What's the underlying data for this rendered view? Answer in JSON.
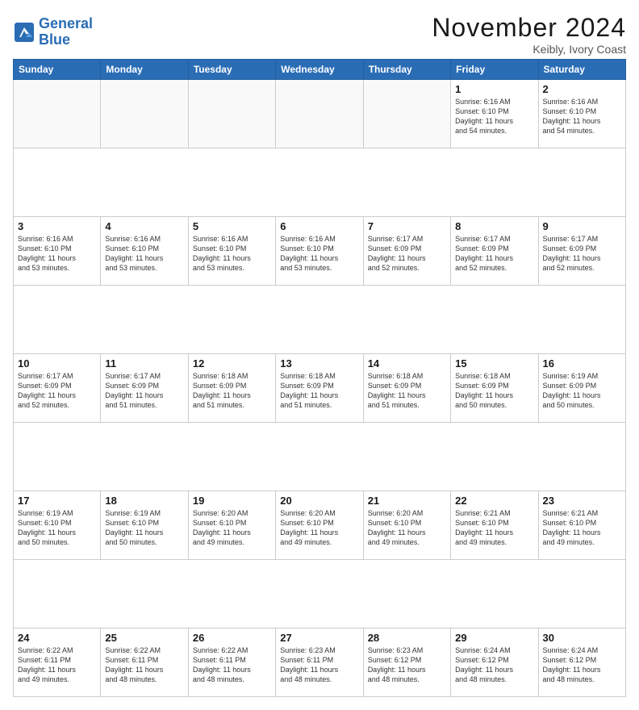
{
  "header": {
    "logo_line1": "General",
    "logo_line2": "Blue",
    "title": "November 2024",
    "location": "Keibly, Ivory Coast"
  },
  "weekdays": [
    "Sunday",
    "Monday",
    "Tuesday",
    "Wednesday",
    "Thursday",
    "Friday",
    "Saturday"
  ],
  "weeks": [
    [
      {
        "day": "",
        "info": ""
      },
      {
        "day": "",
        "info": ""
      },
      {
        "day": "",
        "info": ""
      },
      {
        "day": "",
        "info": ""
      },
      {
        "day": "",
        "info": ""
      },
      {
        "day": "1",
        "info": "Sunrise: 6:16 AM\nSunset: 6:10 PM\nDaylight: 11 hours\nand 54 minutes."
      },
      {
        "day": "2",
        "info": "Sunrise: 6:16 AM\nSunset: 6:10 PM\nDaylight: 11 hours\nand 54 minutes."
      }
    ],
    [
      {
        "day": "3",
        "info": "Sunrise: 6:16 AM\nSunset: 6:10 PM\nDaylight: 11 hours\nand 53 minutes."
      },
      {
        "day": "4",
        "info": "Sunrise: 6:16 AM\nSunset: 6:10 PM\nDaylight: 11 hours\nand 53 minutes."
      },
      {
        "day": "5",
        "info": "Sunrise: 6:16 AM\nSunset: 6:10 PM\nDaylight: 11 hours\nand 53 minutes."
      },
      {
        "day": "6",
        "info": "Sunrise: 6:16 AM\nSunset: 6:10 PM\nDaylight: 11 hours\nand 53 minutes."
      },
      {
        "day": "7",
        "info": "Sunrise: 6:17 AM\nSunset: 6:09 PM\nDaylight: 11 hours\nand 52 minutes."
      },
      {
        "day": "8",
        "info": "Sunrise: 6:17 AM\nSunset: 6:09 PM\nDaylight: 11 hours\nand 52 minutes."
      },
      {
        "day": "9",
        "info": "Sunrise: 6:17 AM\nSunset: 6:09 PM\nDaylight: 11 hours\nand 52 minutes."
      }
    ],
    [
      {
        "day": "10",
        "info": "Sunrise: 6:17 AM\nSunset: 6:09 PM\nDaylight: 11 hours\nand 52 minutes."
      },
      {
        "day": "11",
        "info": "Sunrise: 6:17 AM\nSunset: 6:09 PM\nDaylight: 11 hours\nand 51 minutes."
      },
      {
        "day": "12",
        "info": "Sunrise: 6:18 AM\nSunset: 6:09 PM\nDaylight: 11 hours\nand 51 minutes."
      },
      {
        "day": "13",
        "info": "Sunrise: 6:18 AM\nSunset: 6:09 PM\nDaylight: 11 hours\nand 51 minutes."
      },
      {
        "day": "14",
        "info": "Sunrise: 6:18 AM\nSunset: 6:09 PM\nDaylight: 11 hours\nand 51 minutes."
      },
      {
        "day": "15",
        "info": "Sunrise: 6:18 AM\nSunset: 6:09 PM\nDaylight: 11 hours\nand 50 minutes."
      },
      {
        "day": "16",
        "info": "Sunrise: 6:19 AM\nSunset: 6:09 PM\nDaylight: 11 hours\nand 50 minutes."
      }
    ],
    [
      {
        "day": "17",
        "info": "Sunrise: 6:19 AM\nSunset: 6:10 PM\nDaylight: 11 hours\nand 50 minutes."
      },
      {
        "day": "18",
        "info": "Sunrise: 6:19 AM\nSunset: 6:10 PM\nDaylight: 11 hours\nand 50 minutes."
      },
      {
        "day": "19",
        "info": "Sunrise: 6:20 AM\nSunset: 6:10 PM\nDaylight: 11 hours\nand 49 minutes."
      },
      {
        "day": "20",
        "info": "Sunrise: 6:20 AM\nSunset: 6:10 PM\nDaylight: 11 hours\nand 49 minutes."
      },
      {
        "day": "21",
        "info": "Sunrise: 6:20 AM\nSunset: 6:10 PM\nDaylight: 11 hours\nand 49 minutes."
      },
      {
        "day": "22",
        "info": "Sunrise: 6:21 AM\nSunset: 6:10 PM\nDaylight: 11 hours\nand 49 minutes."
      },
      {
        "day": "23",
        "info": "Sunrise: 6:21 AM\nSunset: 6:10 PM\nDaylight: 11 hours\nand 49 minutes."
      }
    ],
    [
      {
        "day": "24",
        "info": "Sunrise: 6:22 AM\nSunset: 6:11 PM\nDaylight: 11 hours\nand 49 minutes."
      },
      {
        "day": "25",
        "info": "Sunrise: 6:22 AM\nSunset: 6:11 PM\nDaylight: 11 hours\nand 48 minutes."
      },
      {
        "day": "26",
        "info": "Sunrise: 6:22 AM\nSunset: 6:11 PM\nDaylight: 11 hours\nand 48 minutes."
      },
      {
        "day": "27",
        "info": "Sunrise: 6:23 AM\nSunset: 6:11 PM\nDaylight: 11 hours\nand 48 minutes."
      },
      {
        "day": "28",
        "info": "Sunrise: 6:23 AM\nSunset: 6:12 PM\nDaylight: 11 hours\nand 48 minutes."
      },
      {
        "day": "29",
        "info": "Sunrise: 6:24 AM\nSunset: 6:12 PM\nDaylight: 11 hours\nand 48 minutes."
      },
      {
        "day": "30",
        "info": "Sunrise: 6:24 AM\nSunset: 6:12 PM\nDaylight: 11 hours\nand 48 minutes."
      }
    ]
  ]
}
